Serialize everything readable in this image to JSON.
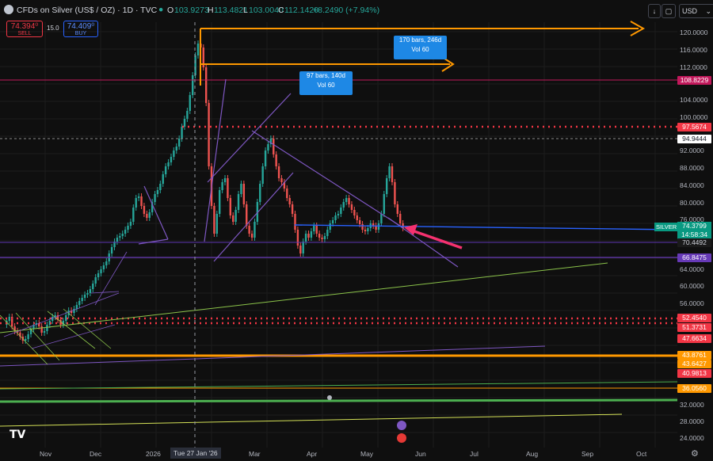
{
  "header": {
    "symbol_title": "CFDs on Silver (US$ / OZ) · 1D · TVC",
    "open_label": "O",
    "open": "103.9273",
    "high_label": "H",
    "high": "113.4821",
    "low_label": "L",
    "low": "103.0040",
    "close_label": "C",
    "close": "112.1420",
    "change": "+8.2490 (+7.94%)",
    "currency": "USD"
  },
  "trade": {
    "sell_price": "74.394⁰",
    "sell_label": "SELL",
    "buy_price": "74.409⁰",
    "buy_label": "BUY",
    "spread": "15.0"
  },
  "price_axis": {
    "ticks": [
      "120.0000",
      "116.0000",
      "112.0000",
      "104.0000",
      "100.0000",
      "92.0000",
      "88.0000",
      "84.0000",
      "80.0000",
      "76.0000",
      "64.0000",
      "60.0000",
      "56.0000",
      "32.0000",
      "28.0000",
      "24.0000"
    ],
    "labels": {
      "l108": "108.8229",
      "l97": "97.5674",
      "l94": "94.9444",
      "silver_name": "SILVER",
      "silver_price": "74.3799",
      "countdown": "14:58:34",
      "l70": "70.4492",
      "l66": "66.8475",
      "l52": "52.4540",
      "l51": "51.3731",
      "l47": "47.6634",
      "l43a": "43.8761",
      "l43b": "43.6427",
      "l40": "40.9813",
      "l36": "36.0560"
    }
  },
  "time_axis": {
    "ticks": [
      "Nov",
      "Dec",
      "2026",
      "Mar",
      "Apr",
      "May",
      "Jun",
      "Jul",
      "Aug",
      "Sep",
      "Oct"
    ],
    "crosshair_label": "Tue 27 Jan '26"
  },
  "measure_boxes": {
    "box1_line1": "170 bars, 246d",
    "box1_line2": "Vol 60",
    "box2_line1": "97 bars, 140d",
    "box2_line2": "Vol 60"
  },
  "colors": {
    "background": "#0f0f0f",
    "up_candle": "#26a69a",
    "down_candle": "#ef5350",
    "accent_blue": "#2962ff",
    "resistance_red": "#f23645",
    "orange": "#ff9800",
    "purple": "#7e57c2",
    "green_line": "#4caf50",
    "arrow_pink": "#f5316f"
  }
}
